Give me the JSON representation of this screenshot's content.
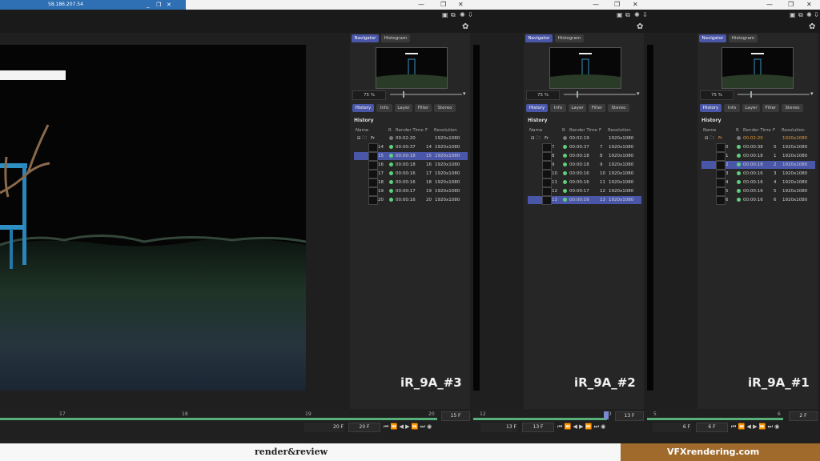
{
  "remote": {
    "ip": "58.186.207.54",
    "ctl_min": "_",
    "ctl_max": "❐",
    "ctl_close": "✕"
  },
  "window_controls": {
    "min": "—",
    "max": "❐",
    "close": "✕"
  },
  "panels": [
    {
      "label": "iR_9A_#3",
      "tabs_top": [
        "Navigator",
        "Histogram"
      ],
      "zoom": "75 %",
      "tabs_mid": [
        "History",
        "Info",
        "Layer",
        "Filter",
        "Stereo"
      ],
      "history_title": "History",
      "columns": [
        "Name",
        "R",
        "Render Time",
        "F",
        "Resolution"
      ],
      "group": {
        "name": "Fr",
        "time": "00:02:20",
        "res": "1920x1080"
      },
      "rows": [
        {
          "num": "14",
          "time": "00:00:37",
          "f": "14",
          "res": "1920x1080",
          "sel": false
        },
        {
          "num": "15",
          "time": "00:00:18",
          "f": "15",
          "res": "1920x1080",
          "sel": true
        },
        {
          "num": "16",
          "time": "00:00:18",
          "f": "16",
          "res": "1920x1080",
          "sel": false
        },
        {
          "num": "17",
          "time": "00:00:16",
          "f": "17",
          "res": "1920x1080",
          "sel": false
        },
        {
          "num": "18",
          "time": "00:00:16",
          "f": "18",
          "res": "1920x1080",
          "sel": false
        },
        {
          "num": "19",
          "time": "00:00:17",
          "f": "19",
          "res": "1920x1080",
          "sel": false
        },
        {
          "num": "20",
          "time": "00:00:16",
          "f": "20",
          "res": "1920x1080",
          "sel": false
        }
      ]
    },
    {
      "label": "iR_9A_#2",
      "tabs_top": [
        "Navigator",
        "Histogram"
      ],
      "zoom": "75 %",
      "tabs_mid": [
        "History",
        "Info",
        "Layer",
        "Filter",
        "Stereo"
      ],
      "history_title": "History",
      "columns": [
        "Name",
        "R",
        "Render Time",
        "F",
        "Resolution"
      ],
      "group": {
        "name": "Fr",
        "time": "00:02:19",
        "res": "1920x1080"
      },
      "rows": [
        {
          "num": "7",
          "time": "00:00:37",
          "f": "7",
          "res": "1920x1080",
          "sel": false
        },
        {
          "num": "8",
          "time": "00:00:18",
          "f": "8",
          "res": "1920x1080",
          "sel": false
        },
        {
          "num": "9",
          "time": "00:00:18",
          "f": "9",
          "res": "1920x1080",
          "sel": false
        },
        {
          "num": "10",
          "time": "00:00:16",
          "f": "10",
          "res": "1920x1080",
          "sel": false
        },
        {
          "num": "11",
          "time": "00:00:16",
          "f": "11",
          "res": "1920x1080",
          "sel": false
        },
        {
          "num": "12",
          "time": "00:00:17",
          "f": "12",
          "res": "1920x1080",
          "sel": false
        },
        {
          "num": "13",
          "time": "00:00:16",
          "f": "13",
          "res": "1920x1080",
          "sel": true
        }
      ]
    },
    {
      "label": "iR_9A_#1",
      "tabs_top": [
        "Navigator",
        "Histogram"
      ],
      "zoom": "75 %",
      "tabs_mid": [
        "History",
        "Info",
        "Layer",
        "Filter",
        "Stereo"
      ],
      "history_title": "History",
      "columns": [
        "Name",
        "R",
        "Render Time",
        "F",
        "Resolution"
      ],
      "group": {
        "name": "Fr",
        "time": "00:02:20",
        "res": "1920x1080"
      },
      "rows": [
        {
          "num": "0",
          "time": "00:00:38",
          "f": "0",
          "res": "1920x1080",
          "sel": false
        },
        {
          "num": "1",
          "time": "00:00:18",
          "f": "1",
          "res": "1920x1080",
          "sel": false
        },
        {
          "num": "2",
          "time": "00:00:18",
          "f": "2",
          "res": "1920x1080",
          "sel": true
        },
        {
          "num": "3",
          "time": "00:00:16",
          "f": "3",
          "res": "1920x1080",
          "sel": false
        },
        {
          "num": "4",
          "time": "00:00:16",
          "f": "4",
          "res": "1920x1080",
          "sel": false
        },
        {
          "num": "5",
          "time": "00:00:16",
          "f": "5",
          "res": "1920x1080",
          "sel": false
        },
        {
          "num": "6",
          "time": "00:00:16",
          "f": "6",
          "res": "1920x1080",
          "sel": false
        }
      ]
    }
  ],
  "timeline": {
    "t3": {
      "ticks": [
        "17",
        "18",
        "19",
        "20"
      ],
      "frame_box": "15 F",
      "end_field": "20 F",
      "current_field": "20 F"
    },
    "t2": {
      "ticks": [
        "12",
        "13"
      ],
      "frame_box": "13 F",
      "end_field": "13 F",
      "current_field": "13 F"
    },
    "t1": {
      "ticks": [
        "5",
        "6"
      ],
      "frame_box": "2 F",
      "end_field": "6 F",
      "current_field": "6 F"
    }
  },
  "transport_glyphs": "⏮ ⏪ ◀ ▶ ⏩ ⏭ ◉",
  "brand": {
    "left": "render&review",
    "right": "VFXrendering.com"
  },
  "colors": {
    "accent": "#4a56a8",
    "render_ok": "#5fd07a",
    "timeline": "#55b07a",
    "brand_bar": "#a06a2c"
  }
}
